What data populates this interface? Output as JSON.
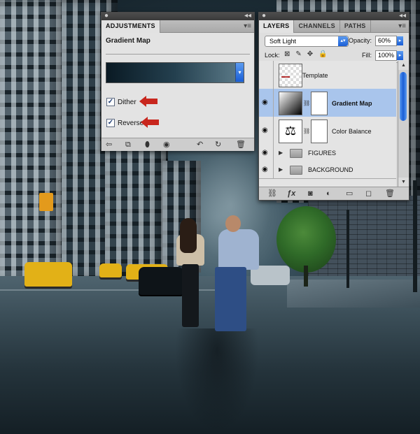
{
  "adjustments_panel": {
    "tab_label": "ADJUSTMENTS",
    "title": "Gradient Map",
    "gradient": {
      "stops": [
        "#0a1a24",
        "#24404f",
        "#5f7e8c"
      ]
    },
    "dither": {
      "label": "Dither",
      "checked": true
    },
    "reverse": {
      "label": "Reverse",
      "checked": true
    },
    "footer_icons": [
      "back-arrow-icon",
      "expand-view-icon",
      "clip-to-layer-icon",
      "visibility-eye-icon",
      "view-previous-icon",
      "reset-icon",
      "trash-icon"
    ]
  },
  "layers_panel": {
    "tabs": [
      {
        "label": "LAYERS",
        "active": true
      },
      {
        "label": "CHANNELS",
        "active": false
      },
      {
        "label": "PATHS",
        "active": false
      }
    ],
    "blend_mode": "Soft Light",
    "opacity_label": "Opacity:",
    "opacity_value": "60%",
    "lock_label": "Lock:",
    "fill_label": "Fill:",
    "fill_value": "100%",
    "layers": [
      {
        "name": "Template",
        "visible": false,
        "selected": false,
        "kind": "image"
      },
      {
        "name": "Gradient Map",
        "visible": true,
        "selected": true,
        "kind": "adjustment"
      },
      {
        "name": "Color Balance",
        "visible": true,
        "selected": false,
        "kind": "adjustment"
      },
      {
        "name": "FIGURES",
        "visible": true,
        "selected": false,
        "kind": "group"
      },
      {
        "name": "BACKGROUND",
        "visible": true,
        "selected": false,
        "kind": "group"
      }
    ]
  },
  "colors": {
    "annotation_arrow": "#c8261d",
    "selection": "#a9c5ec",
    "accent_blue": "#1a5ed6"
  }
}
